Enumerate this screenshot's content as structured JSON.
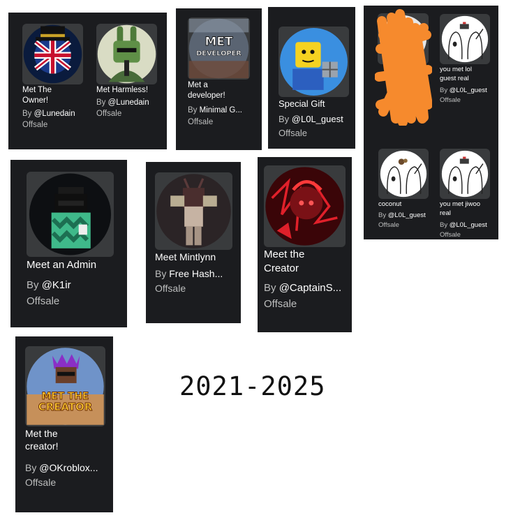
{
  "year_range": "2021-2025",
  "colors": {
    "panel": "#1b1c1f",
    "thumb_bg": "#393b3d",
    "scribble": "#f68a2d"
  },
  "badges": [
    {
      "name": "Met The\nOwner!",
      "by": "By",
      "creator": "@Lunedain",
      "price": "Offsale",
      "icon": "union-jack-tophat-avatar"
    },
    {
      "name": "Met Harmless!",
      "by": "By",
      "creator": "@Lunedain",
      "price": "Offsale",
      "icon": "green-bunny-avatar"
    },
    {
      "name": "Met a\ndeveloper!",
      "by": "By",
      "creator": "Minimal G...",
      "price": "Offsale",
      "icon": "met-developer-badge",
      "icon_text": [
        "MET",
        "DEVELOPER"
      ]
    },
    {
      "name": "Special Gift",
      "by": "By",
      "creator": "@L0L_guest",
      "price": "Offsale",
      "icon": "noob-gift-avatar"
    },
    {
      "name": "",
      "by": "",
      "creator": "",
      "price": "",
      "icon": "scribbled-out-badge"
    },
    {
      "name": "you met lol\nguest real",
      "by": "By",
      "creator": "@L0L_guest",
      "price": "Offsale",
      "icon": "wojak-meme"
    },
    {
      "name": "coconut",
      "by": "By",
      "creator": "@L0L_guest",
      "price": "Offsale",
      "icon": "wojak-coconut-meme"
    },
    {
      "name": "you met jiwoo\nreal",
      "by": "By",
      "creator": "@L0L_guest",
      "price": "Offsale",
      "icon": "wojak-meme"
    },
    {
      "name": "Meet an Admin",
      "by": "By",
      "creator": "@K1ir",
      "price": "Offsale",
      "icon": "admin-avatar"
    },
    {
      "name": "Meet Mintlynn",
      "by": "By",
      "creator": "Free Hash...",
      "price": "Offsale",
      "icon": "mintlynn-avatar"
    },
    {
      "name": "Meet the\nCreator",
      "by": "By",
      "creator": "@CaptainS...",
      "price": "Offsale",
      "icon": "red-creator-avatar"
    },
    {
      "name": "Met the\ncreator!",
      "by": "By",
      "creator": "@OKroblox...",
      "price": "Offsale",
      "icon": "met-the-creator-badge",
      "icon_text": [
        "MET THE",
        "CREATOR"
      ]
    }
  ]
}
